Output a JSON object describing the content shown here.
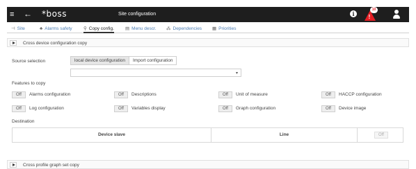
{
  "topbar": {
    "menu_icon": "≡",
    "back_icon": "←",
    "logo": "*boss",
    "title": "Site configuration",
    "info_icon": "i",
    "alarm_count": "10",
    "alarm_mark": "!"
  },
  "tabs": [
    {
      "icon": "⊣",
      "label": "Site"
    },
    {
      "icon": "♣",
      "label": "Alarms safety"
    },
    {
      "icon": "⚲",
      "label": "Copy config."
    },
    {
      "icon": "▤",
      "label": "Menu descr."
    },
    {
      "icon": "⁂",
      "label": "Dependencies"
    },
    {
      "icon": "▦",
      "label": "Priorities"
    }
  ],
  "sections": {
    "device_copy": "Cross device configuration copy",
    "graph_copy": "Cross profile graph set copy"
  },
  "source": {
    "label": "Source selection",
    "options": [
      "local device configuration",
      "Import configuration"
    ],
    "selected": "local device configuration",
    "caret": "▾"
  },
  "features": {
    "label": "Features to copy",
    "items": [
      {
        "state": "Off",
        "label": "Alarms configuration"
      },
      {
        "state": "Off",
        "label": "Descriptions"
      },
      {
        "state": "Off",
        "label": "Unit of measure"
      },
      {
        "state": "Off",
        "label": "HACCP configuration"
      },
      {
        "state": "Off",
        "label": "Log configuration"
      },
      {
        "state": "Off",
        "label": "Variables display"
      },
      {
        "state": "Off",
        "label": "Graph configuration"
      },
      {
        "state": "Off",
        "label": "Device image"
      }
    ]
  },
  "destination": {
    "label": "Destination",
    "col_device": "Device slave",
    "col_line": "Line",
    "toggle": "Off"
  },
  "colors": {
    "topbar": "#1e1e1e",
    "alarm": "#e31e24",
    "tab_link": "#4a7cb3"
  }
}
